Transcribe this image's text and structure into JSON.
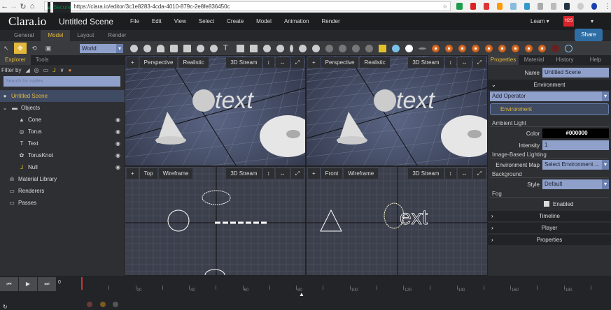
{
  "browser": {
    "secure": "Secure",
    "url": "https://clara.io/editor/3c1e8283-4cda-4010-879c-2e8fe836450c"
  },
  "app": {
    "logo": "Clara.io",
    "scene_title": "Untitled Scene",
    "menus": [
      "File",
      "Edit",
      "View",
      "Select",
      "Create",
      "Model",
      "Animation",
      "Render"
    ],
    "learn": "Learn ▾",
    "badge": "H2S",
    "account": "▾",
    "share": "Share"
  },
  "tabs": [
    "General",
    "Model",
    "Layout",
    "Render"
  ],
  "toolbar": {
    "space": "World"
  },
  "left": {
    "tabs": [
      "Explorer",
      "Tools"
    ],
    "filter_label": "Filter by",
    "search_placeholder": "Search for nodes",
    "tree": [
      {
        "label": "Untitled Scene",
        "icon": "scene-icon"
      },
      {
        "label": "Objects",
        "icon": "folder-icon"
      },
      {
        "label": "Cone",
        "icon": "cone-icon"
      },
      {
        "label": "Torus",
        "icon": "torus-icon"
      },
      {
        "label": "Text",
        "icon": "text-icon"
      },
      {
        "label": "TorusKnot",
        "icon": "torusknot-icon"
      },
      {
        "label": "Null",
        "icon": "null-icon"
      },
      {
        "label": "Material Library",
        "icon": "material-icon"
      },
      {
        "label": "Renderers",
        "icon": "renderer-icon"
      },
      {
        "label": "Passes",
        "icon": "passes-icon"
      }
    ]
  },
  "viewports": [
    {
      "camera": "Perspective",
      "mode": "Realistic",
      "stream": "3D Stream"
    },
    {
      "camera": "Perspective",
      "mode": "Realistic",
      "stream": "3D Stream"
    },
    {
      "camera": "Top",
      "mode": "Wireframe",
      "stream": "3D Stream"
    },
    {
      "camera": "Front",
      "mode": "Wireframe",
      "stream": "3D Stream"
    }
  ],
  "viewport_plus": "+",
  "right": {
    "tabs": [
      "Properties",
      "Material",
      "History",
      "Help"
    ],
    "name_label": "Name",
    "name_value": "Untitled Scene",
    "environment": "Environment",
    "add_operator": "Add Operator",
    "env_item": "Environment",
    "ambient": "Ambient Light",
    "color_label": "Color",
    "color_value": "#000000",
    "intensity_label": "Intensity",
    "intensity_value": "1",
    "ibl": "Image-Based Lighting",
    "envmap_label": "Environment Map",
    "envmap_value": "Select Environment ...",
    "background": "Background",
    "style_label": "Style",
    "style_value": "Default",
    "fog": "Fog",
    "enabled": "Enabled",
    "sections": [
      "Timeline",
      "Player",
      "Properties"
    ]
  },
  "timeline": {
    "current": "0",
    "ticks": [
      "20",
      "40",
      "60",
      "80",
      "100",
      "120",
      "140",
      "160",
      "180"
    ]
  },
  "colors": {
    "accent": "#e3b93b",
    "share": "#2f6ea4",
    "field": "#8fa1cb"
  }
}
